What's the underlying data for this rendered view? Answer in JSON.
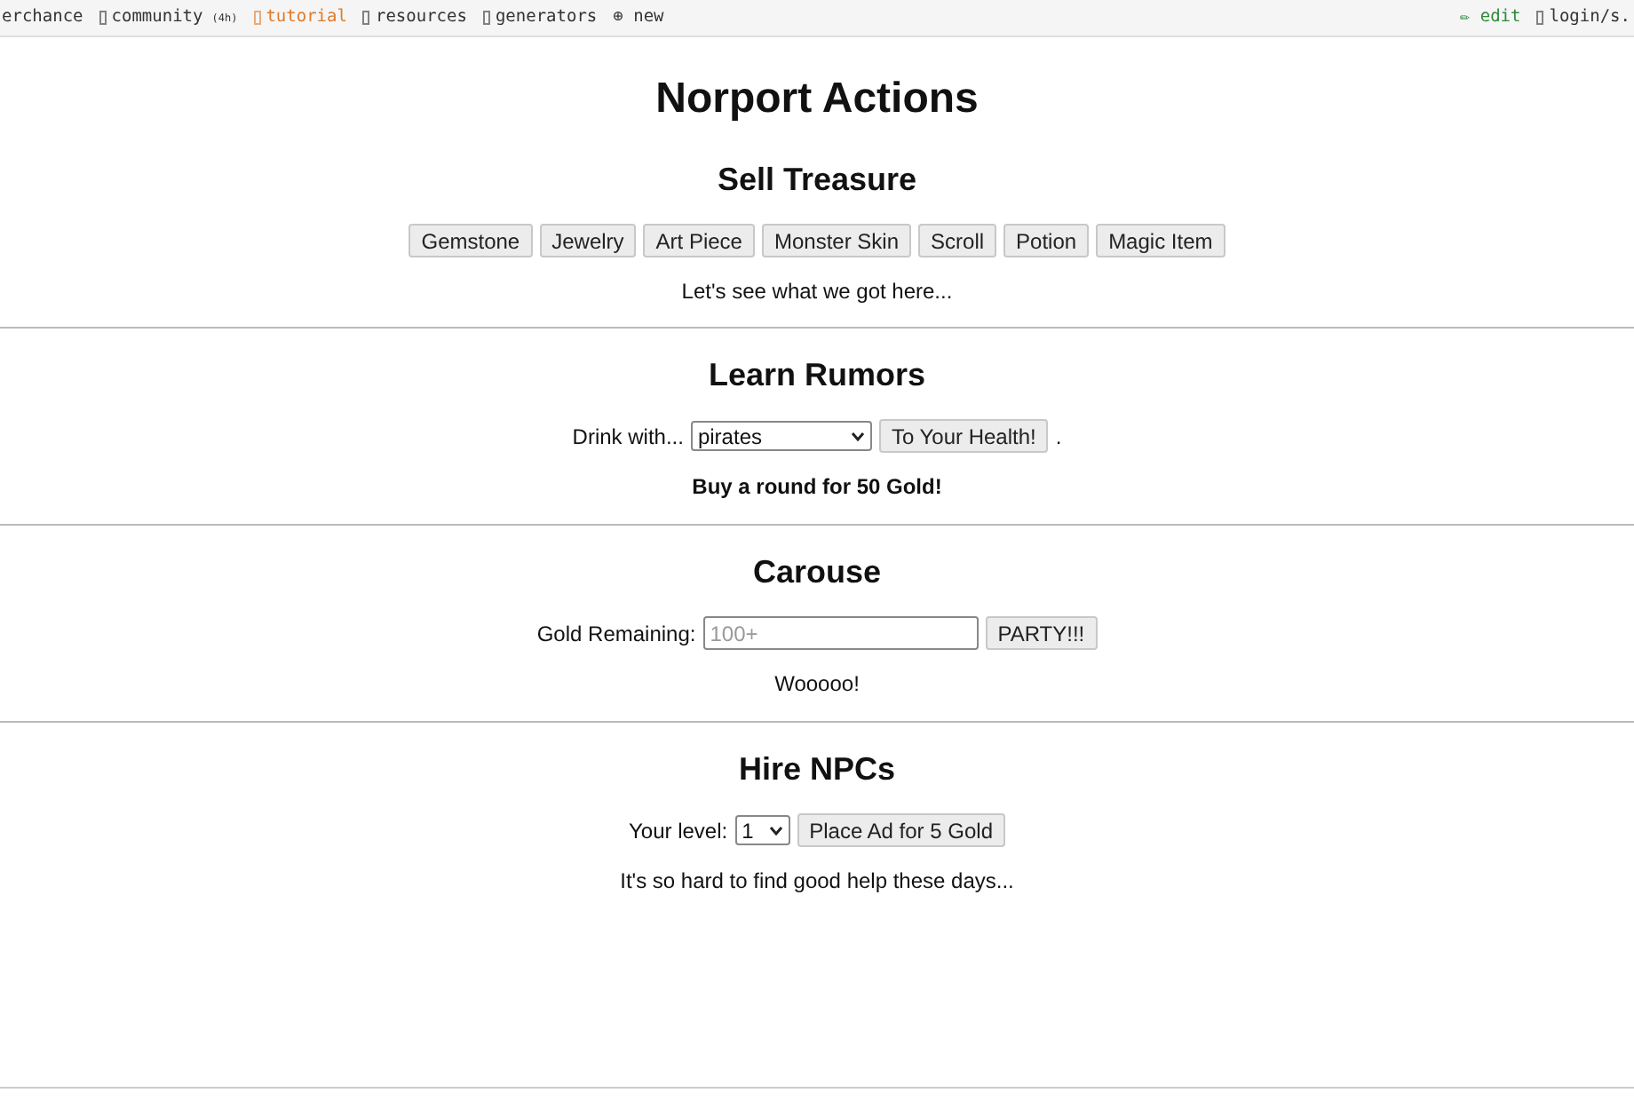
{
  "nav": {
    "left": [
      {
        "label": "erchance",
        "icon": false,
        "color": "#333333"
      },
      {
        "label": "community",
        "icon": true,
        "badge": "(4h)",
        "color": "#333333"
      },
      {
        "label": "tutorial",
        "icon": true,
        "color": "#e07b2a"
      },
      {
        "label": "resources",
        "icon": true,
        "color": "#333333"
      },
      {
        "label": "generators",
        "icon": true,
        "color": "#333333"
      },
      {
        "label": "⊕ new",
        "icon": false,
        "color": "#333333"
      }
    ],
    "right": [
      {
        "label": "✏ edit",
        "icon": false,
        "color": "#2e8b3a"
      },
      {
        "label": "login/s.",
        "icon": true,
        "color": "#333333"
      }
    ]
  },
  "title": "Norport Actions",
  "sections": [
    {
      "heading": "Sell Treasure",
      "controls": [
        {
          "kind": "button",
          "label": "Gemstone"
        },
        {
          "kind": "button",
          "label": "Jewelry"
        },
        {
          "kind": "button",
          "label": "Art Piece"
        },
        {
          "kind": "button",
          "label": "Monster Skin"
        },
        {
          "kind": "button",
          "label": "Scroll"
        },
        {
          "kind": "button",
          "label": "Potion"
        },
        {
          "kind": "button",
          "label": "Magic Item"
        }
      ],
      "note": "Let's see what we got here...",
      "note_bold": false
    },
    {
      "heading": "Learn Rumors",
      "controls": [
        {
          "kind": "label",
          "label": "Drink with..."
        },
        {
          "kind": "select",
          "value": "pirates"
        },
        {
          "kind": "button",
          "label": "To Your Health!"
        },
        {
          "kind": "label",
          "label": "."
        }
      ],
      "note": "Buy a round for 50 Gold!",
      "note_bold": true
    },
    {
      "heading": "Carouse",
      "controls": [
        {
          "kind": "label",
          "label": "Gold Remaining:"
        },
        {
          "kind": "input",
          "placeholder": "100+"
        },
        {
          "kind": "button",
          "label": "PARTY!!!"
        }
      ],
      "note": "Wooooo!",
      "note_bold": false
    },
    {
      "heading": "Hire NPCs",
      "controls": [
        {
          "kind": "label",
          "label": "Your level:"
        },
        {
          "kind": "select",
          "value": "1"
        },
        {
          "kind": "button",
          "label": "Place Ad for 5 Gold"
        }
      ],
      "note": "It's so hard to find good help these days...",
      "note_bold": false
    }
  ]
}
